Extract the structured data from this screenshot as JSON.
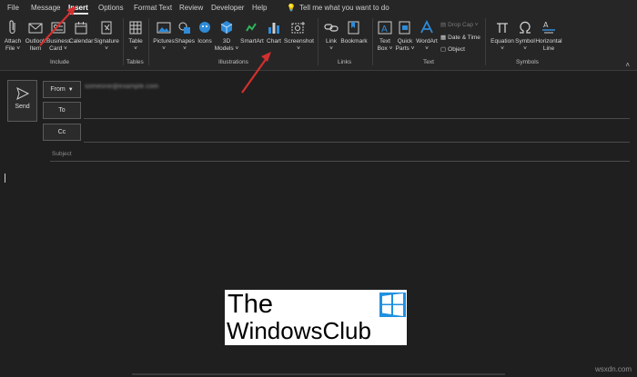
{
  "tabs": [
    "File",
    "Message",
    "Insert",
    "Options",
    "Format Text",
    "Review",
    "Developer",
    "Help"
  ],
  "tell_me": "Tell me what you want to do",
  "ribbon": {
    "include": {
      "label": "Include",
      "items": [
        {
          "l1": "Attach",
          "l2": "File ˅"
        },
        {
          "l1": "Outlook",
          "l2": "Item"
        },
        {
          "l1": "Business",
          "l2": "Card ˅"
        },
        {
          "l1": "Calendar",
          "l2": ""
        },
        {
          "l1": "Signature",
          "l2": "˅"
        }
      ]
    },
    "tables": {
      "label": "Tables",
      "items": [
        {
          "l1": "Table",
          "l2": "˅"
        }
      ]
    },
    "illustrations": {
      "label": "Illustrations",
      "items": [
        {
          "l1": "Pictures",
          "l2": "˅"
        },
        {
          "l1": "Shapes",
          "l2": "˅"
        },
        {
          "l1": "Icons",
          "l2": ""
        },
        {
          "l1": "3D",
          "l2": "Models ˅"
        },
        {
          "l1": "SmartArt",
          "l2": ""
        },
        {
          "l1": "Chart",
          "l2": ""
        },
        {
          "l1": "Screenshot",
          "l2": "˅"
        }
      ]
    },
    "links": {
      "label": "Links",
      "items": [
        {
          "l1": "Link",
          "l2": "˅"
        },
        {
          "l1": "Bookmark",
          "l2": ""
        }
      ]
    },
    "text": {
      "label": "Text",
      "items": [
        {
          "l1": "Text",
          "l2": "Box ˅"
        },
        {
          "l1": "Quick",
          "l2": "Parts ˅"
        },
        {
          "l1": "WordArt",
          "l2": "˅"
        }
      ],
      "small": [
        "Drop Cap ˅",
        "Date & Time",
        "Object"
      ]
    },
    "symbols": {
      "label": "Symbols",
      "items": [
        {
          "l1": "Equation",
          "l2": "˅"
        },
        {
          "l1": "Symbol",
          "l2": "˅"
        },
        {
          "l1": "Horizontal",
          "l2": "Line"
        }
      ]
    },
    "collapse": "˄"
  },
  "compose": {
    "send": "Send",
    "from_label": "From",
    "from_value": "someone@example.com",
    "to_label": "To",
    "cc_label": "Cc",
    "subject_label": "Subject"
  },
  "logo": {
    "line1": "The",
    "line2": "WindowsClub"
  },
  "watermark": "wsxdn.com",
  "colors": {
    "arrow": "#d32f2f",
    "accent": "#2e8bd8",
    "background": "#1f1f1f",
    "ribbon": "#262626"
  }
}
